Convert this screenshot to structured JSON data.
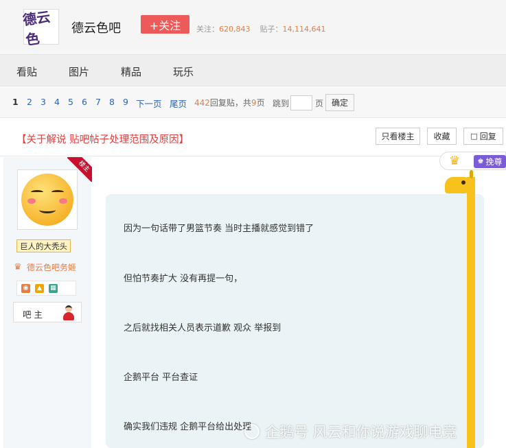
{
  "header": {
    "forum_logo_text": "德云色",
    "forum_name": "德云色吧",
    "follow_label": "+关注",
    "followers_label": "关注：",
    "followers_count": "620,843",
    "posts_label": "贴子：",
    "posts_count": "14,114,641"
  },
  "nav": {
    "items": [
      "看贴",
      "图片",
      "精品",
      "玩乐"
    ]
  },
  "pager": {
    "pages": [
      "1",
      "2",
      "3",
      "4",
      "5",
      "6",
      "7",
      "8",
      "9"
    ],
    "next_label": "下一页",
    "last_label": "尾页",
    "reply_count": "442",
    "reply_text": "回复贴，共",
    "page_total": "9",
    "page_text": "页",
    "jump_label": "跳到",
    "jump_value": "",
    "page_unit": "页",
    "confirm_label": "确定"
  },
  "thread": {
    "title": "【关于解说 贴吧帖子处理范围及原因】",
    "only_op_label": "只看楼主",
    "favorite_label": "收藏",
    "reply_label": "回复"
  },
  "post": {
    "op_ribbon": "楼主",
    "username": "巨人的大秃头",
    "role": "德云色吧务姬",
    "moderator_label": "吧主",
    "exchange_label": "挽尊",
    "paragraphs": [
      "因为一句话带了男篮节奏 当时主播就感觉到错了",
      "但怕节奏扩大 没有再提一句，",
      "之后就找相关人员表示道歉 观众 举报到",
      "企鹅平台 平台查证",
      "确实我们违规 企鹅平台给出处理"
    ]
  },
  "watermark": "企鹅号 风云和你说游戏聊电竞",
  "colors": {
    "accent_red": "#ec5b59",
    "link_blue": "#2d64b3",
    "count_orange": "#e87c41",
    "title_red": "#e23f3f",
    "bubble_bg": "#eaf3f5"
  }
}
